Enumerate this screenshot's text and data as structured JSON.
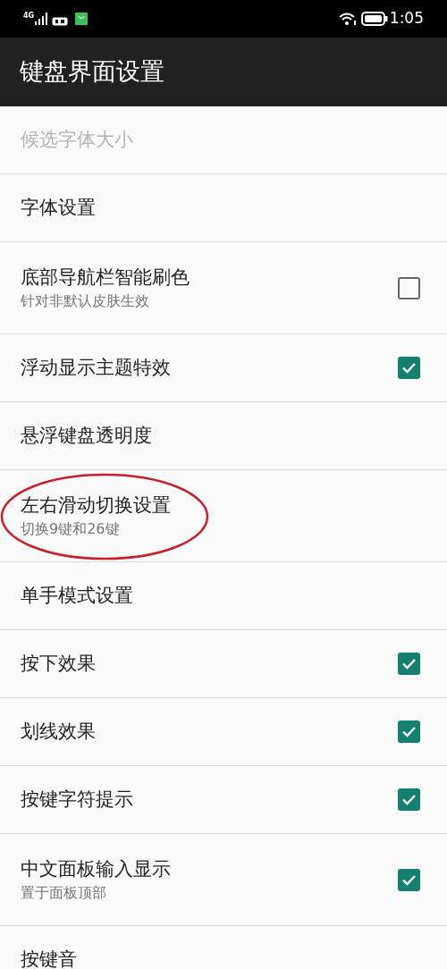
{
  "status_bar": {
    "network": "4G",
    "time": "1:05"
  },
  "app_bar": {
    "title": "键盘界面设置"
  },
  "settings": [
    {
      "title": "候选字体大小",
      "disabled": true
    },
    {
      "title": "字体设置",
      "disabled": false
    },
    {
      "title": "底部导航栏智能刷色",
      "summary": "针对非默认皮肤生效",
      "kind": "checkbox",
      "checked": false,
      "disabled": false
    },
    {
      "title": "浮动显示主题特效",
      "kind": "checkbox",
      "checked": true,
      "disabled": false
    },
    {
      "title": "悬浮键盘透明度",
      "disabled": false
    },
    {
      "title": "左右滑动切换设置",
      "summary": "切换9键和26键",
      "disabled": false,
      "circled": true
    },
    {
      "title": "单手模式设置",
      "disabled": false
    },
    {
      "title": "按下效果",
      "kind": "checkbox",
      "checked": true,
      "disabled": false
    },
    {
      "title": "划线效果",
      "kind": "checkbox",
      "checked": true,
      "disabled": false
    },
    {
      "title": "按键字符提示",
      "kind": "checkbox",
      "checked": true,
      "disabled": false
    },
    {
      "title": "中文面板输入显示",
      "summary": "置于面板顶部",
      "kind": "checkbox",
      "checked": true,
      "disabled": false
    },
    {
      "title": "按键音",
      "disabled": false
    }
  ]
}
